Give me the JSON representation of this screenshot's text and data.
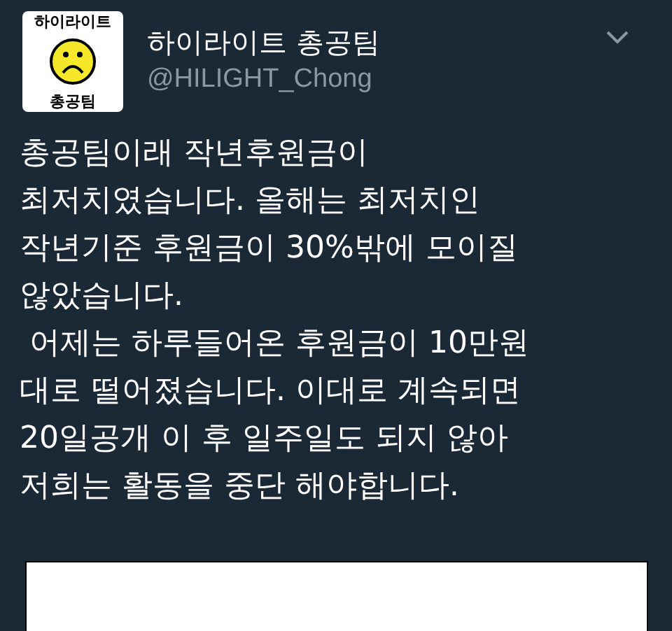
{
  "author": {
    "avatar": {
      "top_text": "하이라이트",
      "bottom_text": "총공팀"
    },
    "name": "하이라이트 총공팀",
    "handle": "@HILIGHT_Chong"
  },
  "tweet": {
    "lines": [
      "총공팀이래 작년후원금이",
      "최저치였습니다. 올해는 최저치인",
      "작년기준 후원금이 30%밖에 모이질",
      "않았습니다.",
      " 어제는 하루들어온 후원금이 10만원",
      "대로 떨어졌습니다. 이대로 계속되면",
      "20일공개 이 후 일주일도 되지 않아",
      "저희는 활동을 중단 해야합니다."
    ]
  },
  "attachment": {
    "kind": "image"
  }
}
